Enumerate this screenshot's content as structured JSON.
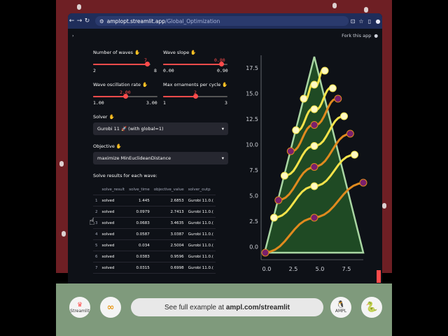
{
  "browser": {
    "url_host": "amplopt.streamlit.app",
    "url_path": "/Global_Optimization"
  },
  "topbar": {
    "fork_label": "Fork this app"
  },
  "sliders": {
    "waves": {
      "label": "Number of waves",
      "value": "7",
      "min": "2",
      "max": "8"
    },
    "slope": {
      "label": "Wave slope",
      "value": "0.80",
      "min": "0.00",
      "max": "0.90"
    },
    "oscillation": {
      "label": "Wave oscillation rate",
      "value": "2.00",
      "min": "1.00",
      "max": "3.00"
    },
    "ornaments": {
      "label": "Max ornaments per cycle",
      "value": "2",
      "min": "1",
      "max": "3"
    }
  },
  "solver": {
    "label": "Solver",
    "value": "Gurobi 11 🚀 (with global=1)"
  },
  "objective": {
    "label": "Objective",
    "value": "maximize MinEuclideanDistance"
  },
  "results": {
    "heading": "Solve results for each wave:",
    "columns": [
      "",
      "solve_result",
      "solve_time",
      "objective_value",
      "solver_outp"
    ],
    "rows": [
      [
        "1",
        "solved",
        "1.445",
        "2.6853",
        "Gurobi 11.0.("
      ],
      [
        "2",
        "solved",
        "0.0979",
        "2.7413",
        "Gurobi 11.0.("
      ],
      [
        "3",
        "solved",
        "0.0683",
        "3.4635",
        "Gurobi 11.0.("
      ],
      [
        "4",
        "solved",
        "0.0587",
        "3.0387",
        "Gurobi 11.0.("
      ],
      [
        "5",
        "solved",
        "0.034",
        "2.5004",
        "Gurobi 11.0.("
      ],
      [
        "6",
        "solved",
        "0.0383",
        "0.9596",
        "Gurobi 11.0.("
      ],
      [
        "7",
        "solved",
        "0.0315",
        "0.6998",
        "Gurobi 11.0.("
      ]
    ]
  },
  "plot": {
    "y_ticks": [
      "17.5",
      "15.0",
      "12.5",
      "10.0",
      "7.5",
      "5.0",
      "2.5",
      "0.0"
    ],
    "x_ticks": [
      "0.0",
      "2.5",
      "5.0",
      "7.5"
    ]
  },
  "footer": {
    "streamlit_label": "Streamlit",
    "pill_text": "See full example at ",
    "pill_link": "ampl.com/streamlit",
    "ampl_label": "AMPL"
  },
  "colors": {
    "frame": "#6e1f24",
    "tree_fill": "#1f4a24",
    "tree_outline": "#a9d6a3",
    "wave_yellow": "#f6e34a",
    "wave_orange": "#e08a1e",
    "ornament": "#7a1f6c",
    "accent": "#ff4b4b"
  }
}
